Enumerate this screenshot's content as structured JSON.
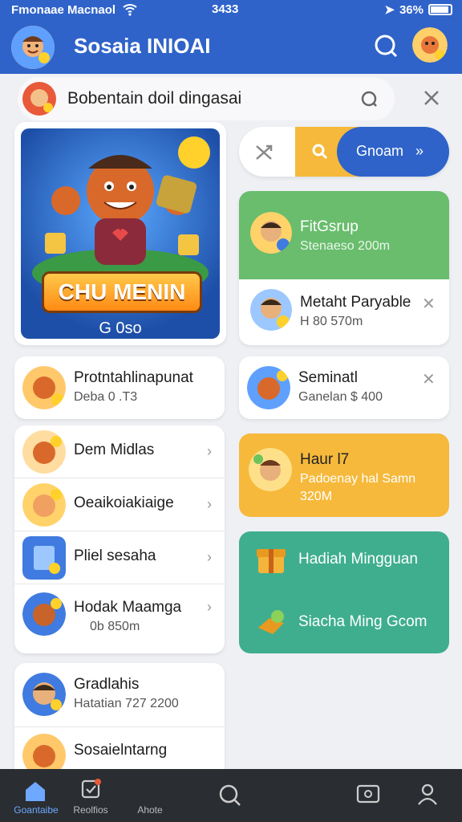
{
  "status": {
    "carrier": "Fmonaae Macnaol",
    "time": "3433",
    "battery": "36%"
  },
  "header": {
    "title": "Sosaia INIOAI"
  },
  "search": {
    "query": "Bobentain doil dingasai"
  },
  "feature": {
    "banner": "CHU MENIN",
    "sub": "G 0so"
  },
  "actions": {
    "go_label": "Gnoam"
  },
  "group": {
    "top_title": "FitGsrup",
    "top_sub": "Stenaeso 200m",
    "bottom_title": "Metaht Paryable",
    "bottom_sub": "H 80 570m"
  },
  "rows": [
    {
      "title": "Protntahlinapunat",
      "sub": "Deba 0 .T3"
    },
    {
      "title": "Seminatl",
      "sub": "Ganelan $ 400"
    }
  ],
  "menu": [
    {
      "label": "Dem Midlas"
    },
    {
      "label": "Oeaikoiakiaige"
    },
    {
      "label": "Pliel sesaha"
    },
    {
      "label": "Hodak Maamga",
      "sub": "0b 850m"
    }
  ],
  "hau": {
    "title": "Haur l7",
    "sub": "Padoenay hal Samn",
    "amount": "320M"
  },
  "teal": {
    "first": "Hadiah Mingguan",
    "second": "Siacha Ming Gcom"
  },
  "people": [
    {
      "title": "Gradlahis",
      "sub": "Hatatian 727 2200"
    },
    {
      "title": "Sosaielntarng",
      "sub": ""
    }
  ],
  "tabs": [
    {
      "label": "Goantaibe"
    },
    {
      "label": "Reolfios"
    },
    {
      "label": "Ahote"
    }
  ],
  "colors": {
    "primary": "#2f63c9",
    "green": "#69bd6d",
    "orange": "#f6b93b",
    "teal": "#3fae8e",
    "tabbar": "#2a2d32"
  }
}
